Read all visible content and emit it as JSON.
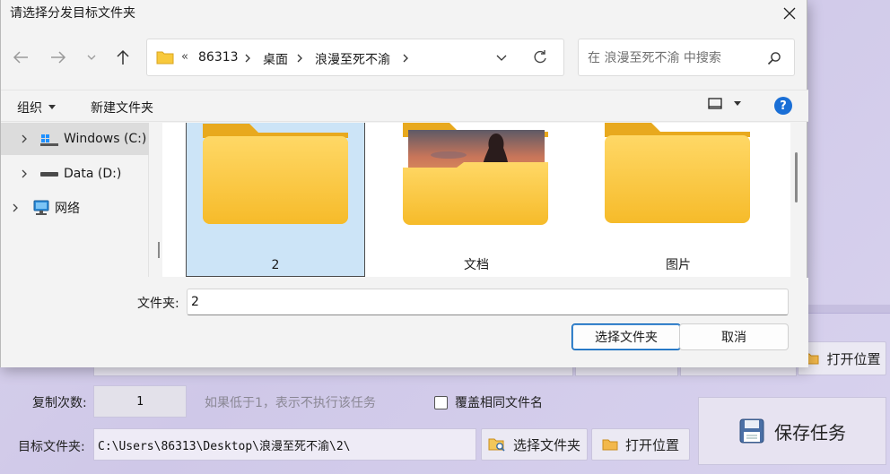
{
  "dialog": {
    "title": "请选择分发目标文件夹",
    "breadcrumb": {
      "overflow": "«",
      "parts": [
        "86313",
        "桌面",
        "浪漫至死不渝"
      ]
    },
    "search_placeholder": "在 浪漫至死不渝 中搜索",
    "commands": {
      "organize": "组织",
      "new_folder": "新建文件夹"
    },
    "sidebar": [
      {
        "label": "Windows (C:)",
        "icon": "windows-drive-icon",
        "selected": true
      },
      {
        "label": "Data (D:)",
        "icon": "drive-icon",
        "selected": false
      },
      {
        "label": "网络",
        "icon": "network-icon",
        "selected": false
      }
    ],
    "folders": [
      {
        "name": "2",
        "selected": true,
        "has_preview": false
      },
      {
        "name": "文档",
        "selected": false,
        "has_preview": true
      },
      {
        "name": "图片",
        "selected": false,
        "has_preview": false
      }
    ],
    "filename_label": "文件夹:",
    "filename_value": "2",
    "buttons": {
      "select": "选择文件夹",
      "cancel": "取消"
    }
  },
  "background_app": {
    "copy_count_label": "复制次数:",
    "copy_count_value": "1",
    "copy_count_hint": "如果低于1，表示不执行该任务",
    "overwrite_label": "覆盖相同文件名",
    "target_label": "目标文件夹:",
    "target_value": "C:\\Users\\86313\\Desktop\\浪漫至死不渝\\2\\",
    "select_folder_btn": "选择文件夹",
    "open_location_btn": "打开位置",
    "open_location_btn_top": "打开位置",
    "save_task_btn": "保存任务"
  },
  "colors": {
    "accent": "#005fb8",
    "selection": "#cce4f7",
    "folder": "#f8c93c",
    "bg_app": "#d6d0ec"
  }
}
